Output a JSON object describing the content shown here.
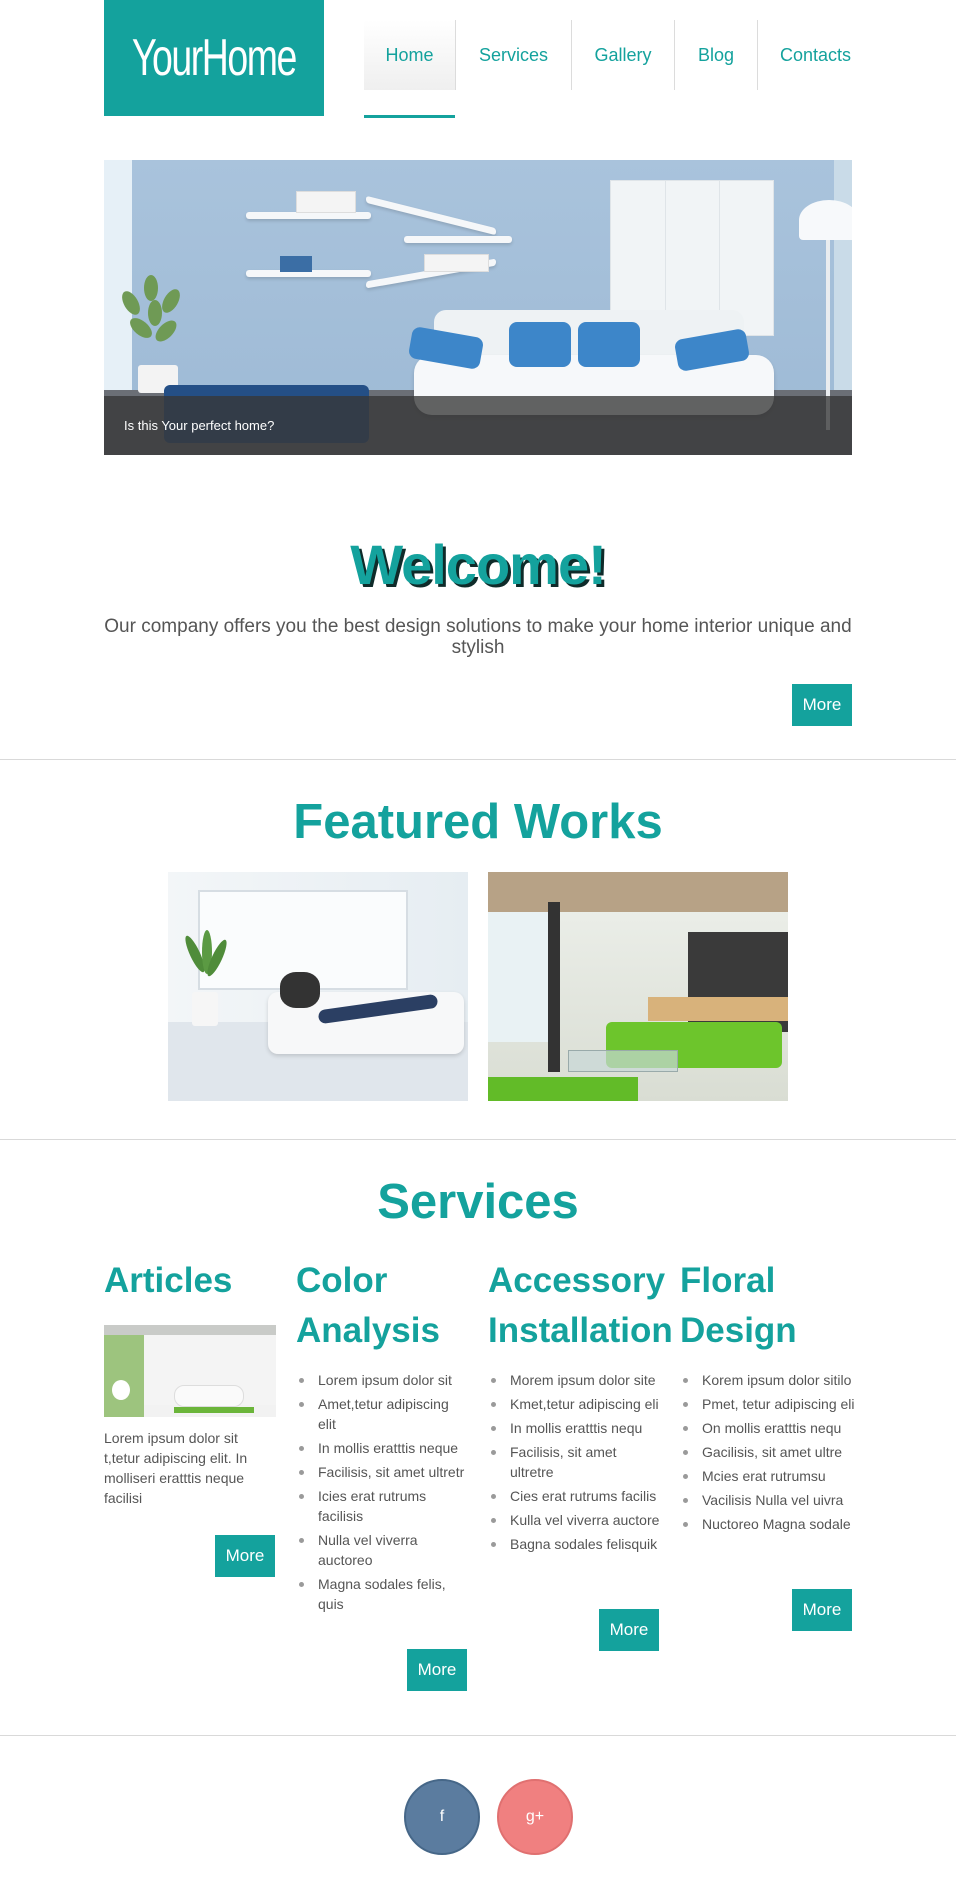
{
  "header": {
    "logo_text": "YourHome",
    "nav": [
      {
        "label": "Home",
        "active": true
      },
      {
        "label": "Services"
      },
      {
        "label": "Gallery"
      },
      {
        "label": "Blog"
      },
      {
        "label": "Contacts"
      }
    ]
  },
  "hero": {
    "caption": "Is this Your perfect home?"
  },
  "welcome": {
    "title": "Welcome!",
    "text": "Our company offers you the best design solutions to make your home interior unique and stylish",
    "more_label": "More"
  },
  "featured": {
    "title": "Featured Works"
  },
  "services": {
    "title": "Services",
    "columns": [
      {
        "title": "Articles",
        "text": "Lorem ipsum dolor sit t,tetur adipiscing elit. In molliseri eratttis neque facilisi",
        "more_label": "More"
      },
      {
        "title": "Color Analysis",
        "items": [
          "Lorem ipsum dolor sit",
          "Amet,tetur adipiscing elit",
          "In mollis eratttis neque",
          "Facilisis, sit amet ultretr",
          "Icies erat rutrums facilisis",
          "Nulla vel viverra auctoreo",
          "Magna sodales felis, quis"
        ],
        "more_label": "More"
      },
      {
        "title": "Accessory Installation",
        "items": [
          "Morem ipsum dolor site",
          "Kmet,tetur adipiscing eli",
          "In mollis eratttis nequ",
          "Facilisis, sit amet ultretre",
          "Cies erat rutrums facilis",
          "Kulla vel viverra auctore",
          "Bagna sodales felisquik"
        ],
        "more_label": "More"
      },
      {
        "title": "Floral Design",
        "items": [
          "Korem ipsum dolor sitilo",
          "Pmet, tetur adipiscing eli",
          "On mollis eratttis nequ",
          "Gacilisis, sit amet ultre",
          "Mcies erat rutrumsu",
          "Vacilisis Nulla vel uivra",
          "Nuctoreo Magna sodale"
        ],
        "more_label": "More"
      }
    ]
  },
  "social": {
    "facebook_label": "f",
    "googleplus_label": "g+"
  },
  "colors": {
    "accent": "#14a29d",
    "facebook": "#5b7c9f",
    "googleplus": "#f08080"
  }
}
